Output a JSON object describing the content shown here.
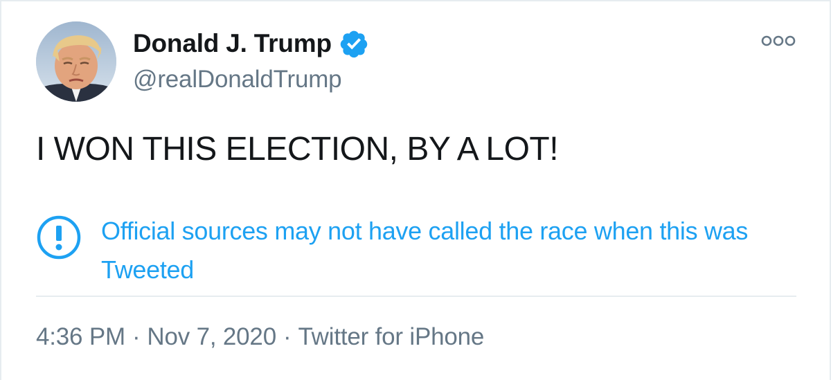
{
  "user": {
    "display_name": "Donald J. Trump",
    "handle": "@realDonaldTrump",
    "verified": true,
    "avatar_icon": "profile-photo"
  },
  "tweet": {
    "text": "I WON THIS ELECTION, BY A LOT!"
  },
  "notice": {
    "icon": "exclamation-circle-icon",
    "text": "Official sources may not have called the race when this was Tweeted"
  },
  "meta": {
    "time": "4:36 PM",
    "separator": "·",
    "date": "Nov 7, 2020",
    "source": "Twitter for iPhone"
  },
  "colors": {
    "link_blue": "#1da1f2",
    "secondary_gray": "#657786",
    "text": "#14171a",
    "border": "#e6ecf0"
  },
  "more_icon": "more-options-icon"
}
